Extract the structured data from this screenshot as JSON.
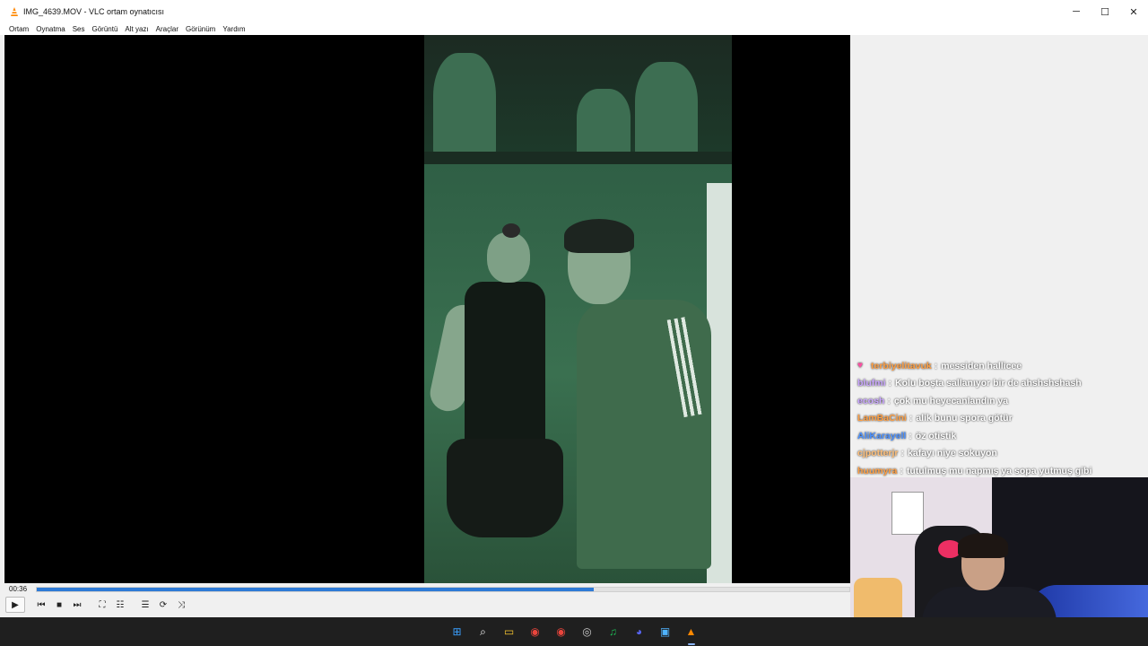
{
  "window": {
    "title": "IMG_4639.MOV - VLC ortam oynatıcısı",
    "minimize": "─",
    "maximize": "☐",
    "close": "✕"
  },
  "menu": [
    "Ortam",
    "Oynatma",
    "Ses",
    "Görüntü",
    "Alt yazı",
    "Araçlar",
    "Görünüm",
    "Yardım"
  ],
  "player": {
    "elapsed": "00:36",
    "progress": 0.685,
    "accent": "#2e7ad6",
    "buttons": {
      "play": "▶",
      "prev": "⏮",
      "stop": "■",
      "next": "⏭",
      "fullscreen": "⛶",
      "extended": "☷",
      "playlist": "☰",
      "loop": "⟳",
      "shuffle": "⤨"
    }
  },
  "chat": [
    {
      "badge": "♥",
      "user": "terbiyelitavuk",
      "color": "#ff9f43",
      "message": "messiden hallicee"
    },
    {
      "badge": "",
      "user": "blufmi",
      "color": "#c9a6ff",
      "message": "Kolu boşta sallanıyor bir de ahshshshash"
    },
    {
      "badge": "",
      "user": "ecosh",
      "color": "#c9a6ff",
      "message": "çok mu heyecanlandın ya"
    },
    {
      "badge": "",
      "user": "LamBaCini",
      "color": "#ff9f43",
      "message": "alik bunu spora götür"
    },
    {
      "badge": "",
      "user": "AliKarayell",
      "color": "#4a90ff",
      "message": "öz otistik"
    },
    {
      "badge": "",
      "user": "cjpotterjr",
      "color": "#ffc07a",
      "message": "kafayı niye sokuyon"
    },
    {
      "badge": "",
      "user": "huumyra",
      "color": "#ff9f43",
      "message": "tutulmuş mu napmış ya sopa yutmuş gibi"
    }
  ],
  "taskbar": [
    {
      "name": "start",
      "glyph": "⊞",
      "color": "#3aa0ff"
    },
    {
      "name": "search",
      "glyph": "⌕",
      "color": "#ffffff"
    },
    {
      "name": "file-explorer",
      "glyph": "▭",
      "color": "#f4c430"
    },
    {
      "name": "chrome",
      "glyph": "◉",
      "color": "#e8453c"
    },
    {
      "name": "chrome-profile",
      "glyph": "◉",
      "color": "#e8453c"
    },
    {
      "name": "obs",
      "glyph": "◎",
      "color": "#cccccc"
    },
    {
      "name": "spotify",
      "glyph": "♫",
      "color": "#1db954"
    },
    {
      "name": "discord",
      "glyph": "◕",
      "color": "#5865f2"
    },
    {
      "name": "photos",
      "glyph": "▣",
      "color": "#4fb3ff"
    },
    {
      "name": "vlc",
      "glyph": "▲",
      "color": "#ff8800"
    }
  ]
}
